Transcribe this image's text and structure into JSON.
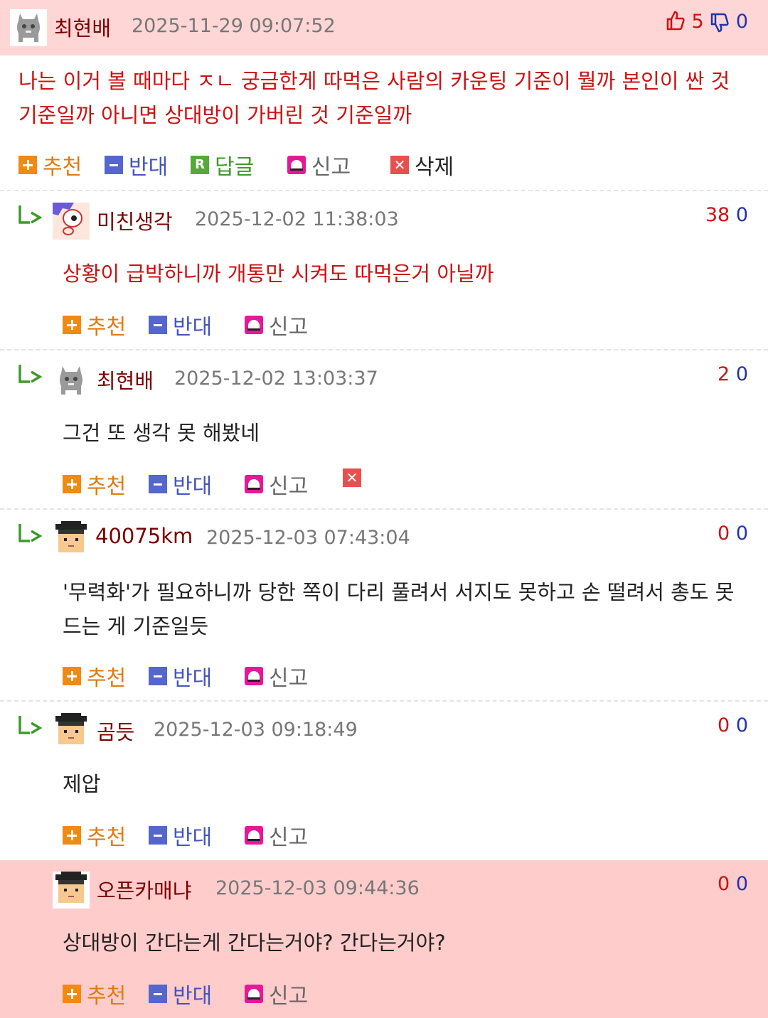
{
  "comments": [
    {
      "author": "최현배",
      "date": "2025-11-29 09:07:52",
      "up": "5",
      "down": "0",
      "body": "나는 이거 볼 때마다 ㅈㄴ 궁금한게 따먹은 사람의 카운팅 기준이 뭘까 본인이 싼 것 기준일까 아니면 상대방이 가버린 것 기준일까",
      "actions": {
        "recommend": "추천",
        "oppose": "반대",
        "reply": "답글",
        "report": "신고",
        "delete": "삭제"
      }
    },
    {
      "author": "미친생각",
      "date": "2025-12-02 11:38:03",
      "up": "38",
      "down": "0",
      "body": "상황이 급박하니까 개통만 시켜도 따먹은거 아닐까",
      "actions": {
        "recommend": "추천",
        "oppose": "반대",
        "report": "신고"
      }
    },
    {
      "author": "최현배",
      "date": "2025-12-02 13:03:37",
      "up": "2",
      "down": "0",
      "body": "그건 또 생각 못 해봤네",
      "actions": {
        "recommend": "추천",
        "oppose": "반대",
        "report": "신고"
      }
    },
    {
      "author": "40075km",
      "date": "2025-12-03 07:43:04",
      "up": "0",
      "down": "0",
      "body": "'무력화'가 필요하니까 당한 쪽이 다리 풀려서 서지도 못하고 손 떨려서 총도 못 드는 게 기준일듯",
      "actions": {
        "recommend": "추천",
        "oppose": "반대",
        "report": "신고"
      }
    },
    {
      "author": "곰듯",
      "date": "2025-12-03 09:18:49",
      "up": "0",
      "down": "0",
      "body": "제압",
      "actions": {
        "recommend": "추천",
        "oppose": "반대",
        "report": "신고"
      }
    },
    {
      "author": "오픈카매냐",
      "date": "2025-12-03 09:44:36",
      "up": "0",
      "down": "0",
      "body": "상대방이 간다는게 간다는거야? 간다는거야?",
      "actions": {
        "recommend": "추천",
        "oppose": "반대",
        "report": "신고"
      }
    }
  ],
  "icons": {
    "thumbs_up": "thumbs-up-icon",
    "thumbs_down": "thumbs-down-icon",
    "reply_arrow": "reply-arrow-icon",
    "recommend": "plus-icon",
    "oppose": "minus-icon",
    "reply": "r-icon",
    "report": "alarm-icon",
    "delete": "x-icon"
  },
  "colors": {
    "highlight_bg": "#ffcccc",
    "header_bg": "#ffd6d6",
    "author": "#7a0000",
    "upvote": "#cc1111",
    "downvote": "#2233aa",
    "recommend": "#e07a10",
    "oppose": "#4455bb",
    "reply": "#3e9a2a",
    "report_icon": "#e6189a",
    "delete_icon": "#e85050"
  }
}
